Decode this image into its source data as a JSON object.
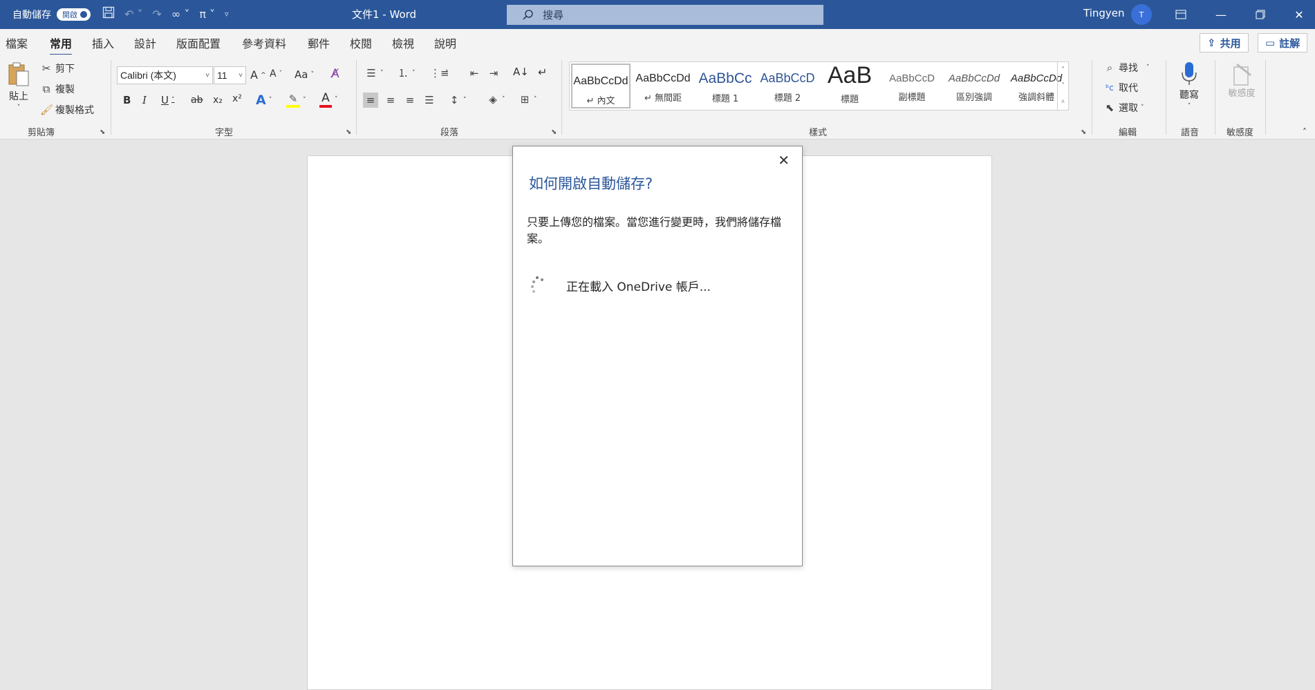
{
  "titlebar": {
    "autosave_label": "自動儲存",
    "autosave_toggle": "開啟",
    "doc_title": "文件1  -  Word",
    "search_placeholder": "搜尋",
    "user_name": "Tingyen",
    "avatar_initial": "T"
  },
  "menu": {
    "tabs": [
      "檔案",
      "常用",
      "插入",
      "設計",
      "版面配置",
      "參考資料",
      "郵件",
      "校閱",
      "檢視",
      "說明"
    ],
    "active_tab": "常用",
    "share_label": "共用",
    "comment_label": "註解"
  },
  "ribbon": {
    "clipboard": {
      "paste": "貼上",
      "cut": "剪下",
      "copy": "複製",
      "format_painter": "複製格式",
      "label": "剪貼簿"
    },
    "font": {
      "font_name": "Calibri (本文)",
      "font_size": "11",
      "grow": "A^",
      "shrink": "Aˇ",
      "case": "Aa",
      "bold": "B",
      "italic": "I",
      "underline": "U",
      "strike": "ab",
      "subscript": "x₂",
      "superscript": "x²",
      "label": "字型"
    },
    "paragraph": {
      "label": "段落"
    },
    "styles": {
      "label": "樣式",
      "items": [
        {
          "preview": "AaBbCcDd",
          "name": "↵ 內文"
        },
        {
          "preview": "AaBbCcDd",
          "name": "↵ 無間距"
        },
        {
          "preview": "AaBbCc",
          "name": "標題 1"
        },
        {
          "preview": "AaBbCcD",
          "name": "標題 2"
        },
        {
          "preview": "AaB",
          "name": "標題"
        },
        {
          "preview": "AaBbCcD",
          "name": "副標題"
        },
        {
          "preview": "AaBbCcDd",
          "name": "區別強調"
        },
        {
          "preview": "AaBbCcDd",
          "name": "強調斜體"
        }
      ]
    },
    "editing": {
      "find": "尋找",
      "replace": "取代",
      "select": "選取",
      "label": "編輯"
    },
    "voice": {
      "dictate": "聽寫",
      "label": "語音"
    },
    "sensitivity": {
      "button": "敏感度",
      "label": "敏感度"
    }
  },
  "dialog": {
    "title": "如何開啟自動儲存?",
    "body": "只要上傳您的檔案。當您進行變更時，我們將儲存檔案。",
    "loading_text": "正在載入 OneDrive 帳戶..."
  },
  "colors": {
    "brand": "#2b579a",
    "highlight": "#ffff00",
    "font_color": "#e81123"
  }
}
